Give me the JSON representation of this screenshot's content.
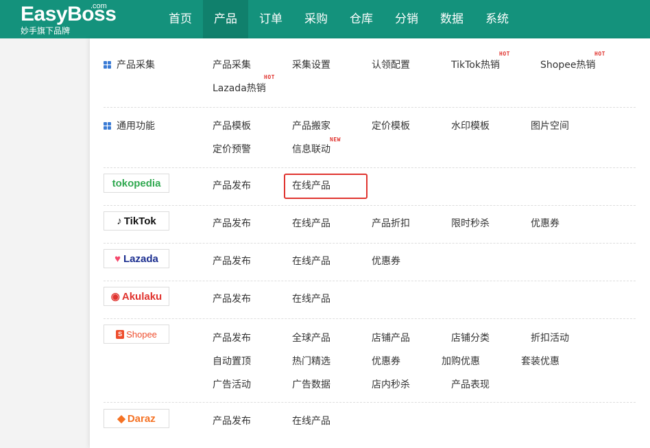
{
  "logo": {
    "main": "EasyBoss",
    "com": ".com",
    "sub": "妙手旗下品牌"
  },
  "nav": [
    "首页",
    "产品",
    "订单",
    "采购",
    "仓库",
    "分销",
    "数据",
    "系统"
  ],
  "active_nav": "产品",
  "sections": {
    "collect": {
      "title": "产品采集",
      "items": [
        "产品采集",
        "采集设置",
        "认领配置",
        "TikTok热销",
        "Shopee热销",
        "Lazada热销"
      ],
      "tags": {
        "tiktok": "HOT",
        "shopee": "HOT",
        "lazada": "HOT"
      }
    },
    "common": {
      "title": "通用功能",
      "items": [
        "产品模板",
        "产品搬家",
        "定价模板",
        "水印模板",
        "图片空间",
        "定价预警",
        "信息联动"
      ],
      "tag_new": "NEW"
    },
    "tokopedia": {
      "brand": "tokopedia",
      "items": [
        "产品发布",
        "在线产品"
      ]
    },
    "tiktok": {
      "brand": "TikTok",
      "items": [
        "产品发布",
        "在线产品",
        "产品折扣",
        "限时秒杀",
        "优惠券"
      ]
    },
    "lazada": {
      "brand": "Lazada",
      "items": [
        "产品发布",
        "在线产品",
        "优惠券"
      ]
    },
    "akulaku": {
      "brand": "Akulaku",
      "items": [
        "产品发布",
        "在线产品"
      ]
    },
    "shopee": {
      "brand": "Shopee",
      "items": [
        "产品发布",
        "全球产品",
        "店铺产品",
        "店铺分类",
        "折扣活动",
        "自动置顶",
        "热门精选",
        "优惠券",
        "加购优惠",
        "套装优惠",
        "广告活动",
        "广告数据",
        "店内秒杀",
        "产品表现"
      ]
    },
    "daraz": {
      "brand": "Daraz",
      "items": [
        "产品发布",
        "在线产品"
      ]
    }
  },
  "colors": {
    "header": "#14927c",
    "tag": "#e0332e",
    "grid_icon": "#3a7bd5"
  }
}
